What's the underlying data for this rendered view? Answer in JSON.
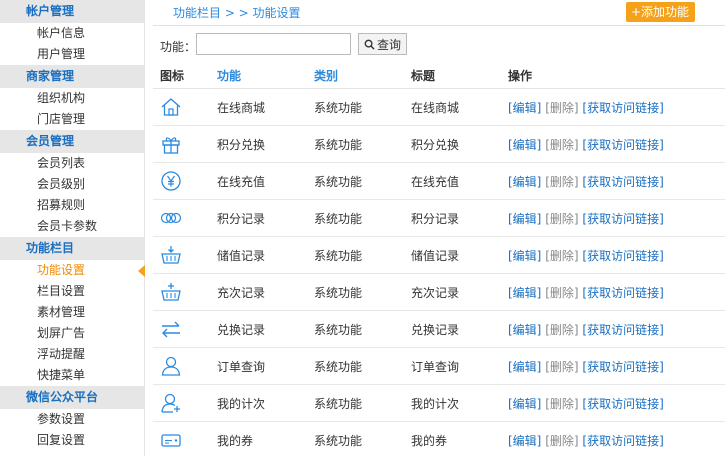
{
  "sidebar": {
    "sections": [
      {
        "title": "帐户管理",
        "items": [
          "帐户信息",
          "用户管理"
        ]
      },
      {
        "title": "商家管理",
        "items": [
          "组织机构",
          "门店管理"
        ]
      },
      {
        "title": "会员管理",
        "items": [
          "会员列表",
          "会员级别",
          "招募规则",
          "会员卡参数"
        ]
      },
      {
        "title": "功能栏目",
        "items": [
          "功能设置",
          "栏目设置",
          "素材管理",
          "划屏广告",
          "浮动提醒",
          "快捷菜单"
        ]
      },
      {
        "title": "微信公众平台",
        "items": [
          "参数设置",
          "回复设置"
        ]
      }
    ],
    "active_item": "功能设置"
  },
  "breadcrumb": "功能栏目 > > 功能设置",
  "add_button": "+添加功能",
  "search": {
    "label": "功能：",
    "value": "",
    "placeholder": "",
    "button": "查询"
  },
  "table": {
    "headers": {
      "icon": "图标",
      "func": "功能",
      "cat": "类别",
      "title": "标题",
      "ops": "操作"
    },
    "rows": [
      {
        "icon": "home-icon",
        "func": "在线商城",
        "cat": "系统功能",
        "title": "在线商城"
      },
      {
        "icon": "gift-icon",
        "func": "积分兑换",
        "cat": "系统功能",
        "title": "积分兑换"
      },
      {
        "icon": "yen-icon",
        "func": "在线充值",
        "cat": "系统功能",
        "title": "在线充值"
      },
      {
        "icon": "coins-icon",
        "func": "积分记录",
        "cat": "系统功能",
        "title": "积分记录"
      },
      {
        "icon": "basket-down-icon",
        "func": "储值记录",
        "cat": "系统功能",
        "title": "储值记录"
      },
      {
        "icon": "basket-plus-icon",
        "func": "充次记录",
        "cat": "系统功能",
        "title": "充次记录"
      },
      {
        "icon": "exchange-arrows-icon",
        "func": "兑换记录",
        "cat": "系统功能",
        "title": "兑换记录"
      },
      {
        "icon": "user-icon",
        "func": "订单查询",
        "cat": "系统功能",
        "title": "订单查询"
      },
      {
        "icon": "user-plus-icon",
        "func": "我的计次",
        "cat": "系统功能",
        "title": "我的计次"
      },
      {
        "icon": "coupon-icon",
        "func": "我的券",
        "cat": "系统功能",
        "title": "我的券"
      }
    ],
    "ops": {
      "edit": "[编辑]",
      "delete": "[删除]",
      "link": "[获取访问链接]"
    }
  },
  "colors": {
    "accent": "#f5a21a",
    "link": "#1a6fc0",
    "icon": "#2a8ae0"
  }
}
